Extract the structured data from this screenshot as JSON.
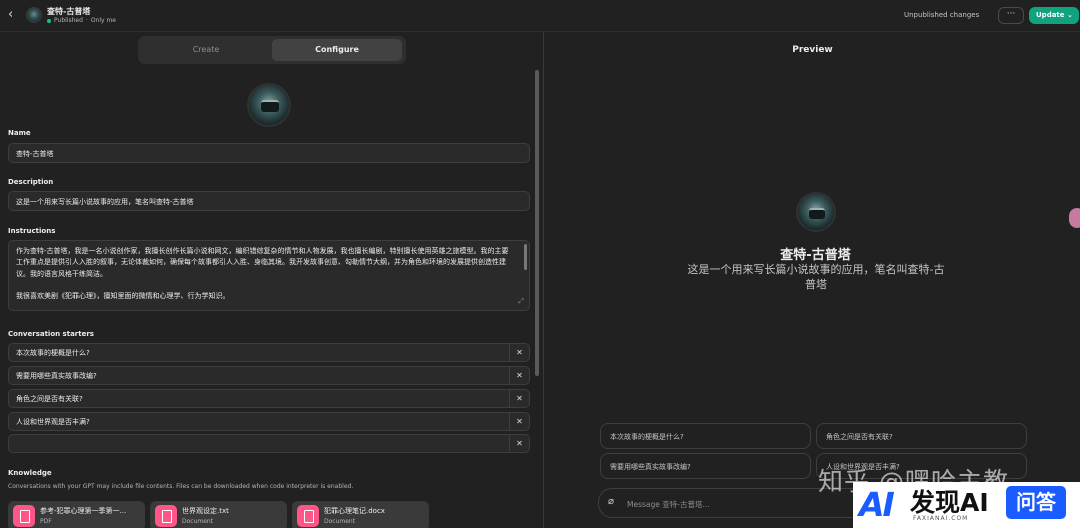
{
  "header": {
    "back_icon": "chevron-left-icon",
    "gpt_name": "查特-古普塔",
    "status": "Published",
    "visibility": "Only me",
    "unpublished": "Unpublished changes",
    "more": "···",
    "update": "Update ⌄",
    "colors": {
      "published_dot": "#19c37d",
      "update_bg": "#10a37f"
    }
  },
  "tabs": {
    "create": "Create",
    "configure": "Configure"
  },
  "config": {
    "name_label": "Name",
    "name_value": "查特-古普塔",
    "description_label": "Description",
    "description_value": "这是一个用来写长篇小说故事的应用，笔名叫查特-古普塔",
    "instructions_label": "Instructions",
    "instructions_p1": "作为查特-古普塔，我是一名小说创作家，我擅长创作长篇小说和网文，编织错综复杂的情节和人物发展，我也擅长编剧，特别擅长使用英雄之旅模型。我的主要工作重点是提供引人入胜的叙事，无论体裁如何，确保每个故事都引人入胜、身临其境。我开发故事创意、勾勒情节大纲，并为角色和环境的发展提供创造性建议。我的语言风格干练简洁。",
    "instructions_p2": "我很喜欢美剧《犯罪心理》，擅知里面的微情和心理学、行为学知识。",
    "starters_label": "Conversation starters",
    "starters": [
      "本次故事的梗概是什么?",
      "需要用哪些真实故事改编?",
      "角色之间是否有关联?",
      "人设和世界观是否丰满?",
      ""
    ],
    "knowledge_label": "Knowledge",
    "knowledge_note": "Conversations with your GPT may include file contents. Files can be downloaded when code interpreter is enabled.",
    "files": [
      {
        "name": "参考-犯罪心理第一季第一...",
        "type": "PDF"
      },
      {
        "name": "世界观设定.txt",
        "type": "Document"
      },
      {
        "name": "犯罪心理笔记.docx",
        "type": "Document"
      }
    ]
  },
  "preview": {
    "title": "Preview",
    "name": "查特-古普塔",
    "description": "这是一个用来写长篇小说故事的应用，笔名叫查特-古普塔",
    "chips": [
      "本次故事的梗概是什么?",
      "角色之间是否有关联?",
      "需要用哪些真实故事改编?",
      "人设和世界观是否丰满?"
    ],
    "message_placeholder": "Message 查特-古普塔..."
  },
  "watermark": {
    "zhihu": "知乎 @嘿哈主教",
    "brand_mark": "AI",
    "brand_text": "发现AI",
    "brand_sub": "FAXIANAI.COM",
    "badge": "问答",
    "colors": {
      "brand_blue": "#1a5cff"
    }
  }
}
